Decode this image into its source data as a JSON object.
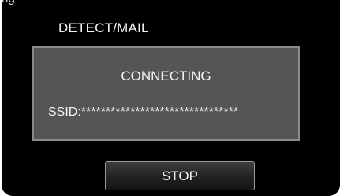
{
  "header": {
    "top_fragment": "ng",
    "title": "DETECT/MAIL"
  },
  "dialog": {
    "status": "CONNECTING",
    "ssid_label": "SSID:",
    "ssid_value": "********************************"
  },
  "actions": {
    "stop_label": "STOP"
  },
  "colors": {
    "screen_background": "#000000",
    "dialog_background": "#555555",
    "dialog_border": "#8a8a8a",
    "text": "#f2f2f2"
  }
}
